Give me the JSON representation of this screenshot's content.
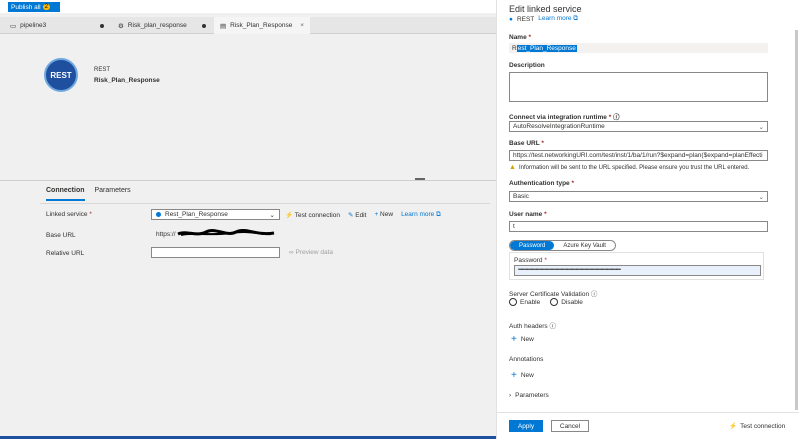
{
  "toolbar": {
    "publish_label": "Publish all",
    "publish_count": "2"
  },
  "tabs": [
    {
      "label": "pipeline3",
      "icon": "pipeline-icon",
      "dirty": true
    },
    {
      "label": "Risk_plan_response",
      "icon": "dataflow-icon",
      "dirty": true
    },
    {
      "label": "Risk_Plan_Response",
      "icon": "dataset-icon",
      "close": "×"
    }
  ],
  "dataset": {
    "type": "REST",
    "name": "Risk_Plan_Response",
    "icon_text": "REST"
  },
  "props": {
    "tabs": [
      "Connection",
      "Parameters"
    ],
    "linked_service_label": "Linked service",
    "linked_service_value": "Rest_Plan_Response",
    "test_connection": "Test connection",
    "edit": "Edit",
    "new": "New",
    "learn_more": "Learn more",
    "base_url_label": "Base URL",
    "base_url_value": "https://",
    "relative_url_label": "Relative URL",
    "preview_data": "Preview data"
  },
  "panel": {
    "title": "Edit linked service",
    "subtitle": "REST",
    "learn_more": "Learn more",
    "name_label": "Name",
    "name_value_first": "R",
    "name_value_rest": "est_Plan_Response",
    "description_label": "Description",
    "runtime_label": "Connect via integration runtime",
    "runtime_value": "AutoResolveIntegrationRuntime",
    "base_url_label": "Base URL",
    "base_url_value": "https://test.networkingURI.com/test/inst/1/ba/1/run?$expand=plan($expand=planEffecti",
    "warning": "Information will be sent to the URL specified. Please ensure you trust the URL entered.",
    "auth_label": "Authentication type",
    "auth_value": "Basic",
    "user_label": "User name",
    "user_value": "t",
    "pw_toggle": [
      "Password",
      "Azure Key Vault"
    ],
    "pw_label": "Password",
    "pw_value": "••••••••••••••••••••••••••••••••••••••••••••••••••••••••••••••••••••••••••••••••••",
    "scv_label": "Server Certificate Validation",
    "scv_options": [
      "Enable",
      "Disable"
    ],
    "auth_headers_label": "Auth headers",
    "new_label": "New",
    "annotations_label": "Annotations",
    "parameters_label": "Parameters",
    "apply": "Apply",
    "cancel": "Cancel",
    "test_connection": "Test connection"
  }
}
